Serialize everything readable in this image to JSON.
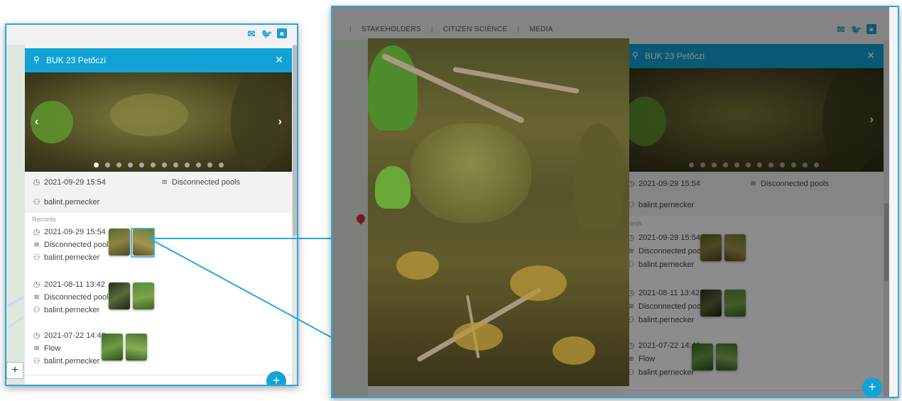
{
  "app": {
    "nav": [
      "STAKEHOLDERS",
      "CITIZEN SCIENCE",
      "MEDIA"
    ],
    "social_icons": [
      "mail-icon",
      "twitter-icon",
      "instagram-icon"
    ]
  },
  "panel": {
    "title": "BUK 23 Petőczi",
    "summary": {
      "datetime": "2021-09-29 15:54",
      "status": "Disconnected pools",
      "user": "balint.pernecker"
    },
    "records_label": "Records",
    "records": [
      {
        "datetime": "2021-09-29 15:54",
        "status": "Disconnected pools",
        "user": "balint.pernecker"
      },
      {
        "datetime": "2021-08-11 13:42",
        "status": "Disconnected pools",
        "user": "balint.pernecker"
      },
      {
        "datetime": "2021-07-22 14:40",
        "status": "Flow",
        "user": "balint.pernecker"
      }
    ],
    "right_records_label": "cords"
  },
  "map": {
    "zoom_in": "+",
    "fab": "+"
  },
  "colors": {
    "accent": "#11a3d6",
    "callout": "#29a8dc"
  }
}
